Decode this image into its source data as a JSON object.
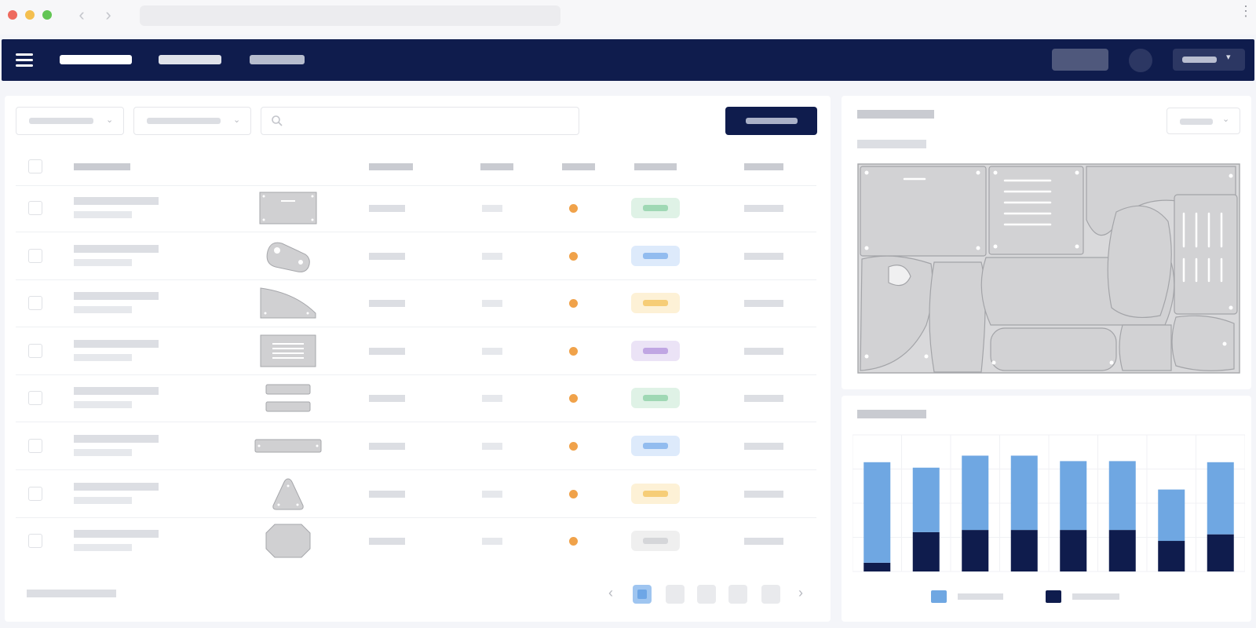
{
  "browser": {
    "window_dots": [
      "#ee6a5e",
      "#f4bf4f",
      "#62c554"
    ],
    "back_glyph": "‹",
    "forward_glyph": "›",
    "menu_glyph": "⋮"
  },
  "header": {
    "menu_icon": "hamburger-icon",
    "nav_items": 3,
    "active_nav_index": 0,
    "brand_color": "#0f1c4d"
  },
  "toolbar": {
    "filters": 2,
    "search_icon": "search-icon",
    "primary_button_color": "#0f1c4d"
  },
  "table": {
    "columns": 7,
    "rows": [
      {
        "thumb_icon": "rectangular-plate-icon",
        "status_color": "#f0a24a",
        "badge_bg": "#dff2e6",
        "badge_bar": "#9fd8b4"
      },
      {
        "thumb_icon": "bracket-link-icon",
        "status_color": "#f0a24a",
        "badge_bg": "#ddeafb",
        "badge_bar": "#92bcef"
      },
      {
        "thumb_icon": "curved-plate-icon",
        "status_color": "#f0a24a",
        "badge_bg": "#fdf1d6",
        "badge_bar": "#f6cd77"
      },
      {
        "thumb_icon": "vent-panel-icon",
        "status_color": "#f0a24a",
        "badge_bg": "#ebe3f6",
        "badge_bar": "#c0a6e3"
      },
      {
        "thumb_icon": "stacked-bars-icon",
        "status_color": "#f0a24a",
        "badge_bg": "#dff2e6",
        "badge_bar": "#9fd8b4"
      },
      {
        "thumb_icon": "flat-bar-icon",
        "status_color": "#f0a24a",
        "badge_bg": "#ddeafb",
        "badge_bar": "#92bcef"
      },
      {
        "thumb_icon": "triangle-plate-icon",
        "status_color": "#f0a24a",
        "badge_bg": "#fdf1d6",
        "badge_bar": "#f6cd77"
      },
      {
        "thumb_icon": "octagon-plate-icon",
        "status_color": "#f0a24a",
        "badge_bg": "#efefef",
        "badge_bar": "#d5d6d9"
      }
    ]
  },
  "pagination": {
    "pages": 5,
    "active_page_index": 0,
    "prev_glyph": "‹",
    "next_glyph": "›"
  },
  "nesting_preview": {
    "sheet_icon": "nested-sheet-layout-icon"
  },
  "chart_data": {
    "type": "bar",
    "stacked": true,
    "categories": [
      "",
      "",
      "",
      "",
      "",
      "",
      "",
      ""
    ],
    "series": [
      {
        "values": [
          8,
          36,
          38,
          38,
          38,
          38,
          28,
          34
        ],
        "color": "#0f1c4d"
      },
      {
        "values": [
          92,
          59,
          68,
          68,
          63,
          63,
          47,
          66
        ],
        "color": "#6fa7e2"
      }
    ],
    "ylim": [
      0,
      125
    ],
    "grid": true,
    "legend": "bottom"
  }
}
